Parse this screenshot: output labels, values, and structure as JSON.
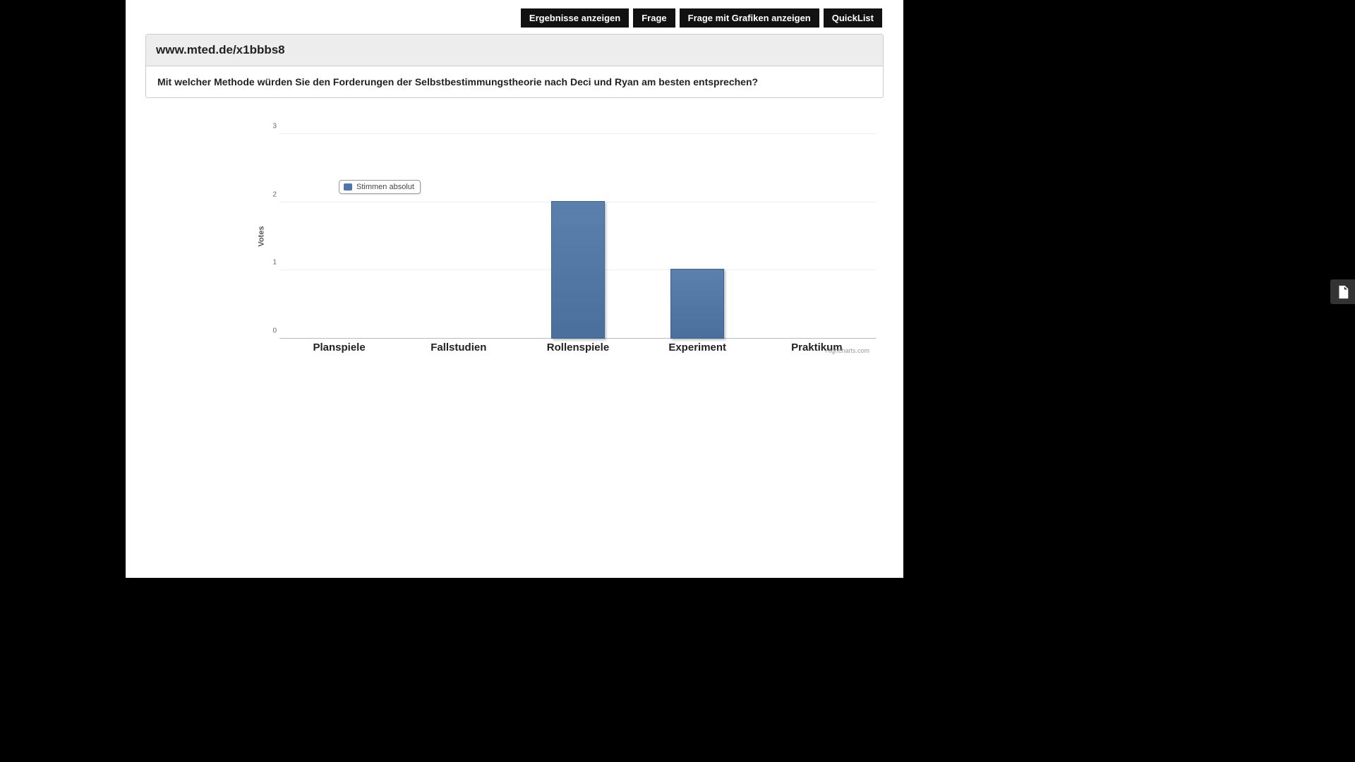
{
  "toolbar": {
    "results_label": "Ergebnisse anzeigen",
    "question_label": "Frage",
    "question_graphics_label": "Frage mit Grafiken anzeigen",
    "quicklist_label": "QuickList"
  },
  "panel": {
    "url_title": "www.mted.de/x1bbbs8",
    "question_text": "Mit welcher Methode würden Sie den Forderungen der Selbstbestimmungstheorie nach Deci und Ryan am besten entsprechen?"
  },
  "chart": {
    "ylabel": "Votes",
    "y_ticks": [
      "0",
      "1",
      "2",
      "3"
    ],
    "legend_label": "Stimmen absolut",
    "credit": "Highcharts.com",
    "categories": [
      "Planspiele",
      "Fallstudien",
      "Rollenspiele",
      "Experiment",
      "Praktikum"
    ]
  },
  "chart_data": {
    "type": "bar",
    "title": "",
    "xlabel": "",
    "ylabel": "Votes",
    "ylim": [
      0,
      3
    ],
    "categories": [
      "Planspiele",
      "Fallstudien",
      "Rollenspiele",
      "Experiment",
      "Praktikum"
    ],
    "series": [
      {
        "name": "Stimmen absolut",
        "values": [
          0,
          0,
          2,
          1,
          0
        ]
      }
    ]
  }
}
